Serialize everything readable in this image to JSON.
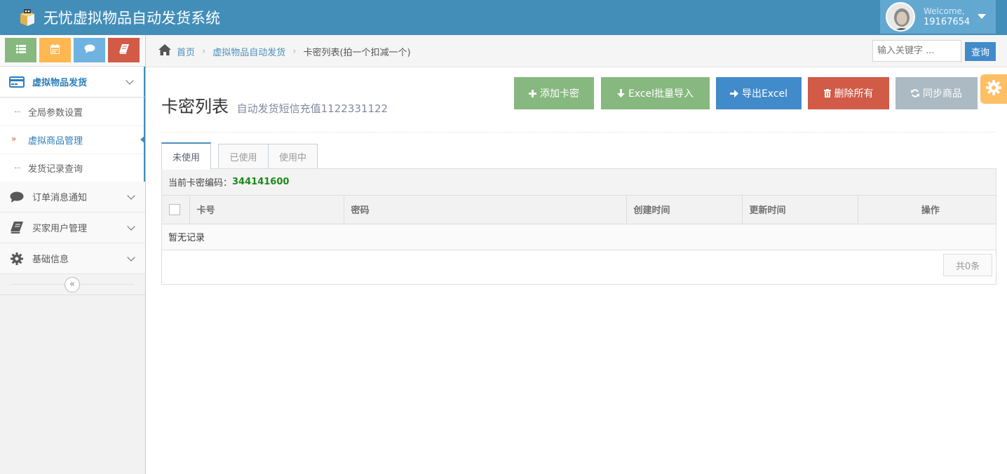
{
  "app": {
    "title": "无忧虚拟物品自动发货系统",
    "logo_icon": "box-logo-icon"
  },
  "user": {
    "welcome": "Welcome,",
    "name": "19167654",
    "avatar_icon": "user-avatar",
    "caret_icon": "caret-down-icon"
  },
  "shortcuts": [
    {
      "icon": "list-icon",
      "color": "#87b87f"
    },
    {
      "icon": "calendar-icon",
      "color": "#ffb752"
    },
    {
      "icon": "comment-icon",
      "color": "#6fb3e0"
    },
    {
      "icon": "book-icon",
      "color": "#d15b47"
    }
  ],
  "sidebar": {
    "menu1": {
      "label": "虚拟物品发货",
      "icon": "credit-card-icon"
    },
    "submenu": [
      {
        "label": "全局参数设置"
      },
      {
        "label": "虚拟商品管理",
        "active": true
      },
      {
        "label": "发货记录查询"
      }
    ],
    "menu2": {
      "label": "订单消息通知",
      "icon": "comment-icon"
    },
    "menu3": {
      "label": "买家用户管理",
      "icon": "book-icon"
    },
    "menu4": {
      "label": "基础信息",
      "icon": "gear-icon"
    },
    "collapse_symbol": "«"
  },
  "breadcrumb": {
    "home": "首页",
    "level2": "虚拟物品自动发货",
    "current": "卡密列表(拍一个扣减一个)"
  },
  "search": {
    "placeholder": "输入关键字 ...",
    "button": "查询"
  },
  "header": {
    "title": "卡密列表",
    "subtitle": "自动发货短信充值1122331122"
  },
  "toolbar": {
    "add": "添加卡密",
    "import": "Excel批量导入",
    "export": "导出Excel",
    "delete_all": "删除所有",
    "sync": "同步商品"
  },
  "colors": {
    "navbar": "#438eb9",
    "green": "#87b87f",
    "blue": "#428bca",
    "red": "#d15b47",
    "grey": "#abbac3",
    "orange": "#ffb44b"
  },
  "tabs": [
    {
      "label": "未使用",
      "active": true
    },
    {
      "label": "已使用"
    },
    {
      "label": "使用中"
    }
  ],
  "card_code": {
    "label": "当前卡密编码：",
    "value": "344141600"
  },
  "table": {
    "columns": [
      "卡号",
      "密码",
      "创建时间",
      "更新时间",
      "操作"
    ],
    "empty_text": "暂无记录"
  },
  "pager": {
    "total": "共0条"
  }
}
